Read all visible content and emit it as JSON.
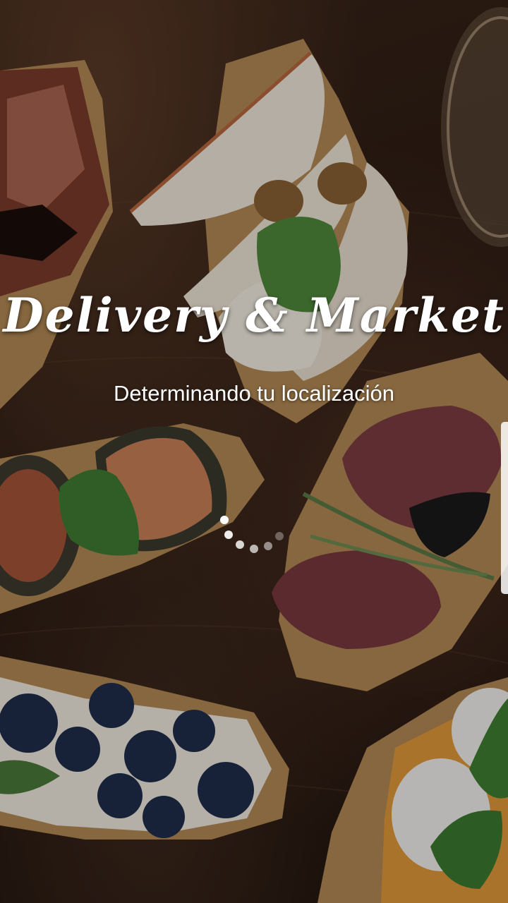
{
  "app": {
    "title": "Delivery & Market",
    "status_message": "Determinando tu localización"
  },
  "loading": {
    "state": "loading"
  },
  "colors": {
    "text": "#ffffff",
    "background_tint": "#2a1b13"
  },
  "icons": {
    "spinner": "loading-spinner-icon"
  }
}
